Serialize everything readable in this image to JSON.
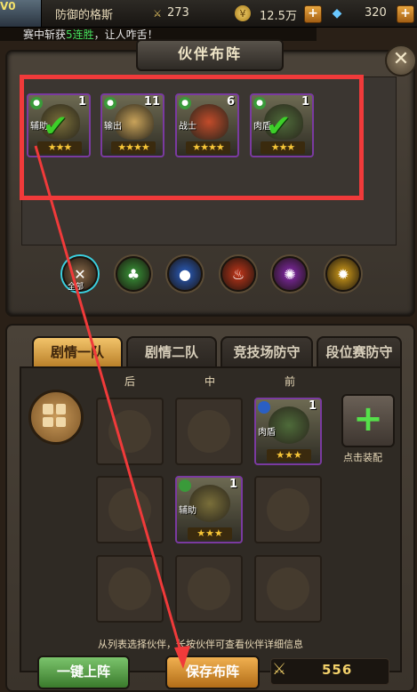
{
  "topbar": {
    "vip": "V0",
    "player_name": "防御的格斯",
    "stamina": "273",
    "gold": "12.5万",
    "diamonds": "320",
    "stamina_icon": "crossed-swords-icon",
    "gold_icon": "coin-icon",
    "diamond_icon": "diamond-icon"
  },
  "ticker": {
    "prefix": "赛中斩获",
    "highlight": "5连胜",
    "suffix": "，让人咋舌！"
  },
  "panel": {
    "title": "伙伴布阵",
    "close": "✕"
  },
  "partners": [
    {
      "role": "辅助",
      "level": "1",
      "stars": "★★★",
      "selected": true,
      "color": "#7a6f3a"
    },
    {
      "role": "输出",
      "level": "11",
      "stars": "★★★★",
      "selected": false,
      "color": "#c9a35a"
    },
    {
      "role": "战士",
      "level": "6",
      "stars": "★★★★",
      "selected": false,
      "color": "#c24b2a"
    },
    {
      "role": "肉盾",
      "level": "1",
      "stars": "★★★",
      "selected": true,
      "color": "#4e6b3a"
    }
  ],
  "filters": [
    {
      "name": "all",
      "label": "全部",
      "color": "#8a6a4a"
    },
    {
      "name": "wind",
      "label": "",
      "color": "#3a9a3a"
    },
    {
      "name": "water",
      "label": "",
      "color": "#2a5fc4"
    },
    {
      "name": "fire",
      "label": "",
      "color": "#c4361a"
    },
    {
      "name": "dark",
      "label": "",
      "color": "#8a2ab2"
    },
    {
      "name": "light",
      "label": "",
      "color": "#d9a21a"
    }
  ],
  "tabs": [
    "剧情一队",
    "剧情二队",
    "竞技场防守",
    "段位赛防守"
  ],
  "columns": [
    "后",
    "中",
    "前"
  ],
  "formation": {
    "front_top": {
      "role": "肉盾",
      "level": "1",
      "stars": "★★★"
    },
    "mid_center": {
      "role": "辅助",
      "level": "1",
      "stars": "★★★"
    }
  },
  "add_label": "点击装配",
  "hint": "从列表选择伙伴，长按伙伴可查看伙伴详细信息",
  "buttons": {
    "auto": "一键上阵",
    "save": "保存布阵"
  },
  "power": "556"
}
